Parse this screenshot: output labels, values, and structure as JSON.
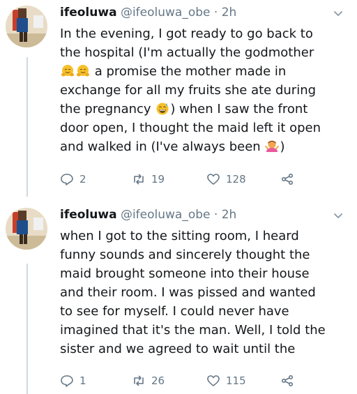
{
  "tweets": [
    {
      "name": "ifeoluwa",
      "handle_time": "@ifeoluwa_obe · 2h",
      "text_1": "In the evening, I got ready to go back to\nthe hospital (I'm actually the godmother\n",
      "text_2": " a promise the mother made in\nexchange for all my fruits she ate during\nthe pregnancy ",
      "text_3": ") when I saw the front\ndoor open, I thought the maid left it open\nand walked in (I've always been ",
      "text_4": ")",
      "emojis": [
        "hugging-face-emoji",
        "hugging-face-emoji",
        "grinning-sweat-emoji",
        "person-shrugging-emoji"
      ],
      "replies": "2",
      "retweets": "19",
      "likes": "128"
    },
    {
      "name": "ifeoluwa",
      "handle_time": "@ifeoluwa_obe · 2h",
      "text": "when I got to the sitting room, I heard\nfunny sounds and sincerely thought the\nmaid brought someone into their house\nand their room. I was pissed and wanted\nto see for myself. I could never have\nimagined that it's the man. Well, I told the\nsister and we agreed to wait until the",
      "replies": "1",
      "retweets": "26",
      "likes": "115"
    }
  ],
  "colors": {
    "text": "#14171a",
    "secondary": "#657786",
    "thread_line": "#cfd9de",
    "emoji_yellow": "#f7c02a"
  }
}
